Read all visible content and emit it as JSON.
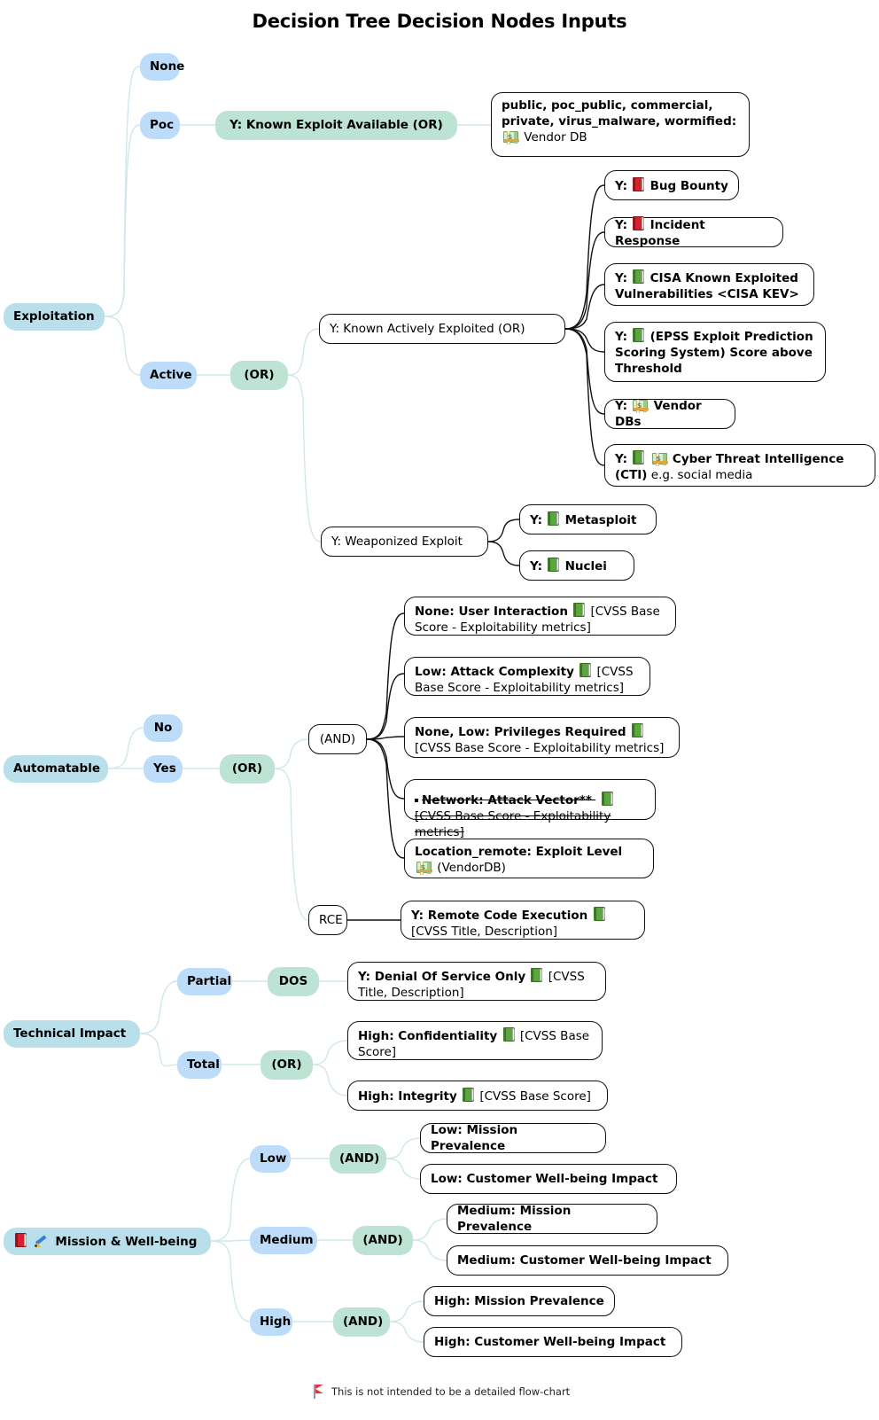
{
  "title": "Decision Tree Decision Nodes Inputs",
  "colors": {
    "root_node": "#b9e0ea",
    "level2_node": "#bcdcfa",
    "operator_node": "#bde3d4",
    "leaf_node": "#ffffff",
    "leaf_border": "#111111",
    "link": "#cfe7ec",
    "dark_link": "#111111",
    "book_red": "#d3212e",
    "book_green": "#5aa83c",
    "money_green": "#9ccb8c",
    "flag_red": "#e8334a"
  },
  "footer": {
    "icon": "red-flag-icon",
    "text": "This is not intended to be a detailed flow-chart"
  },
  "branches": {
    "exploitation": {
      "label": "Exploitation",
      "children": {
        "none": {
          "label": "None"
        },
        "poc": {
          "label": "Poc"
        },
        "active": {
          "label": "Active"
        }
      },
      "poc_operator": {
        "label": "Y: Known Exploit Available (OR)"
      },
      "poc_detail": {
        "bold": "public, poc_public, commercial, private, virus_malware, wormified:",
        "icon": "money-icon",
        "regular": "Vendor DB"
      },
      "active_operator": {
        "label": "(OR)"
      },
      "known_actively_exploited": {
        "label": "Y: Known Actively Exploited (OR)"
      },
      "known_actively_exploited_children": [
        {
          "prefix": "Y:",
          "icons": [
            "book-red-icon"
          ],
          "bold": "Bug Bounty",
          "regular": ""
        },
        {
          "prefix": "Y:",
          "icons": [
            "book-red-icon"
          ],
          "bold": "Incident Response",
          "regular": ""
        },
        {
          "prefix": "Y:",
          "icons": [
            "book-green-icon"
          ],
          "bold": "CISA Known Exploited Vulnerabilities <CISA KEV>",
          "regular": ""
        },
        {
          "prefix": "Y:",
          "icons": [
            "book-green-icon"
          ],
          "bold": "(EPSS Exploit Prediction Scoring System) Score above Threshold",
          "regular": ""
        },
        {
          "prefix": "Y:",
          "icons": [
            "money-icon"
          ],
          "bold": "Vendor DBs",
          "regular": ""
        },
        {
          "prefix": "Y:",
          "icons": [
            "book-green-icon",
            "money-icon"
          ],
          "bold": "Cyber Threat Intelligence (CTI)",
          "regular": " e.g. social media"
        }
      ],
      "weaponized_exploit": {
        "label": "Y: Weaponized Exploit"
      },
      "weaponized_exploit_children": [
        {
          "prefix": "Y:",
          "icons": [
            "book-green-icon"
          ],
          "bold": "Metasploit",
          "regular": ""
        },
        {
          "prefix": "Y:",
          "icons": [
            "book-green-icon"
          ],
          "bold": "Nuclei",
          "regular": ""
        }
      ]
    },
    "automatable": {
      "label": "Automatable",
      "children": {
        "no": {
          "label": "No"
        },
        "yes": {
          "label": "Yes"
        }
      },
      "yes_operator": {
        "label": "(OR)"
      },
      "and_operator": {
        "label": "(AND)"
      },
      "and_children": [
        {
          "bold": "None: User Interaction",
          "icons": [
            "book-green-icon"
          ],
          "regular": " [CVSS Base Score - Exploitability metrics]",
          "struck": false,
          "bullet": false
        },
        {
          "bold": "Low: Attack Complexity",
          "icons": [
            "book-green-icon"
          ],
          "regular": " [CVSS Base Score - Exploitability metrics]",
          "struck": false,
          "bullet": false
        },
        {
          "bold": "None, Low: Privileges Required",
          "icons": [
            "book-green-icon"
          ],
          "regular": " [CVSS Base Score - Exploitability metrics]",
          "struck": false,
          "bullet": false
        },
        {
          "bold": "Network: Attack Vector**",
          "icons": [
            "book-green-icon"
          ],
          "regular": " [CVSS Base Score - Exploitability metrics]",
          "struck": true,
          "bullet": true
        },
        {
          "bold": "Location_remote: Exploit Level",
          "icons": [
            "money-icon"
          ],
          "regular": " (VendorDB)",
          "struck": false,
          "bullet": false
        }
      ],
      "rce_operator": {
        "label": "RCE"
      },
      "rce_child": {
        "bold": "Y: Remote Code Execution",
        "icons": [
          "book-green-icon"
        ],
        "regular": " [CVSS Title, Description]"
      }
    },
    "technical_impact": {
      "label": "Technical Impact",
      "children": {
        "partial": {
          "label": "Partial"
        },
        "total": {
          "label": "Total"
        }
      },
      "dos_operator": {
        "label": "DOS"
      },
      "dos_child": {
        "bold": "Y: Denial Of Service Only",
        "icons": [
          "book-green-icon"
        ],
        "regular": " [CVSS Title, Description]"
      },
      "total_operator": {
        "label": "(OR)"
      },
      "total_children": [
        {
          "bold": "High: Confidentiality",
          "icons": [
            "book-green-icon"
          ],
          "regular": " [CVSS Base Score]"
        },
        {
          "bold": "High: Integrity",
          "icons": [
            "book-green-icon"
          ],
          "regular": " [CVSS Base Score]"
        }
      ]
    },
    "mission_wellbeing": {
      "label": "Mission & Well-being",
      "icons": [
        "book-red-icon",
        "pencil-icon"
      ],
      "children": {
        "low": {
          "label": "Low"
        },
        "medium": {
          "label": "Medium"
        },
        "high": {
          "label": "High"
        }
      },
      "low_operator": {
        "label": "(AND)"
      },
      "low_children": [
        {
          "label": "Low: Mission Prevalence"
        },
        {
          "label": "Low: Customer Well-being Impact"
        }
      ],
      "medium_operator": {
        "label": "(AND)"
      },
      "medium_children": [
        {
          "label": "Medium: Mission Prevalence"
        },
        {
          "label": "Medium: Customer Well-being Impact"
        }
      ],
      "high_operator": {
        "label": "(AND)"
      },
      "high_children": [
        {
          "label": "High: Mission Prevalence"
        },
        {
          "label": "High: Customer Well-being Impact"
        }
      ]
    }
  }
}
